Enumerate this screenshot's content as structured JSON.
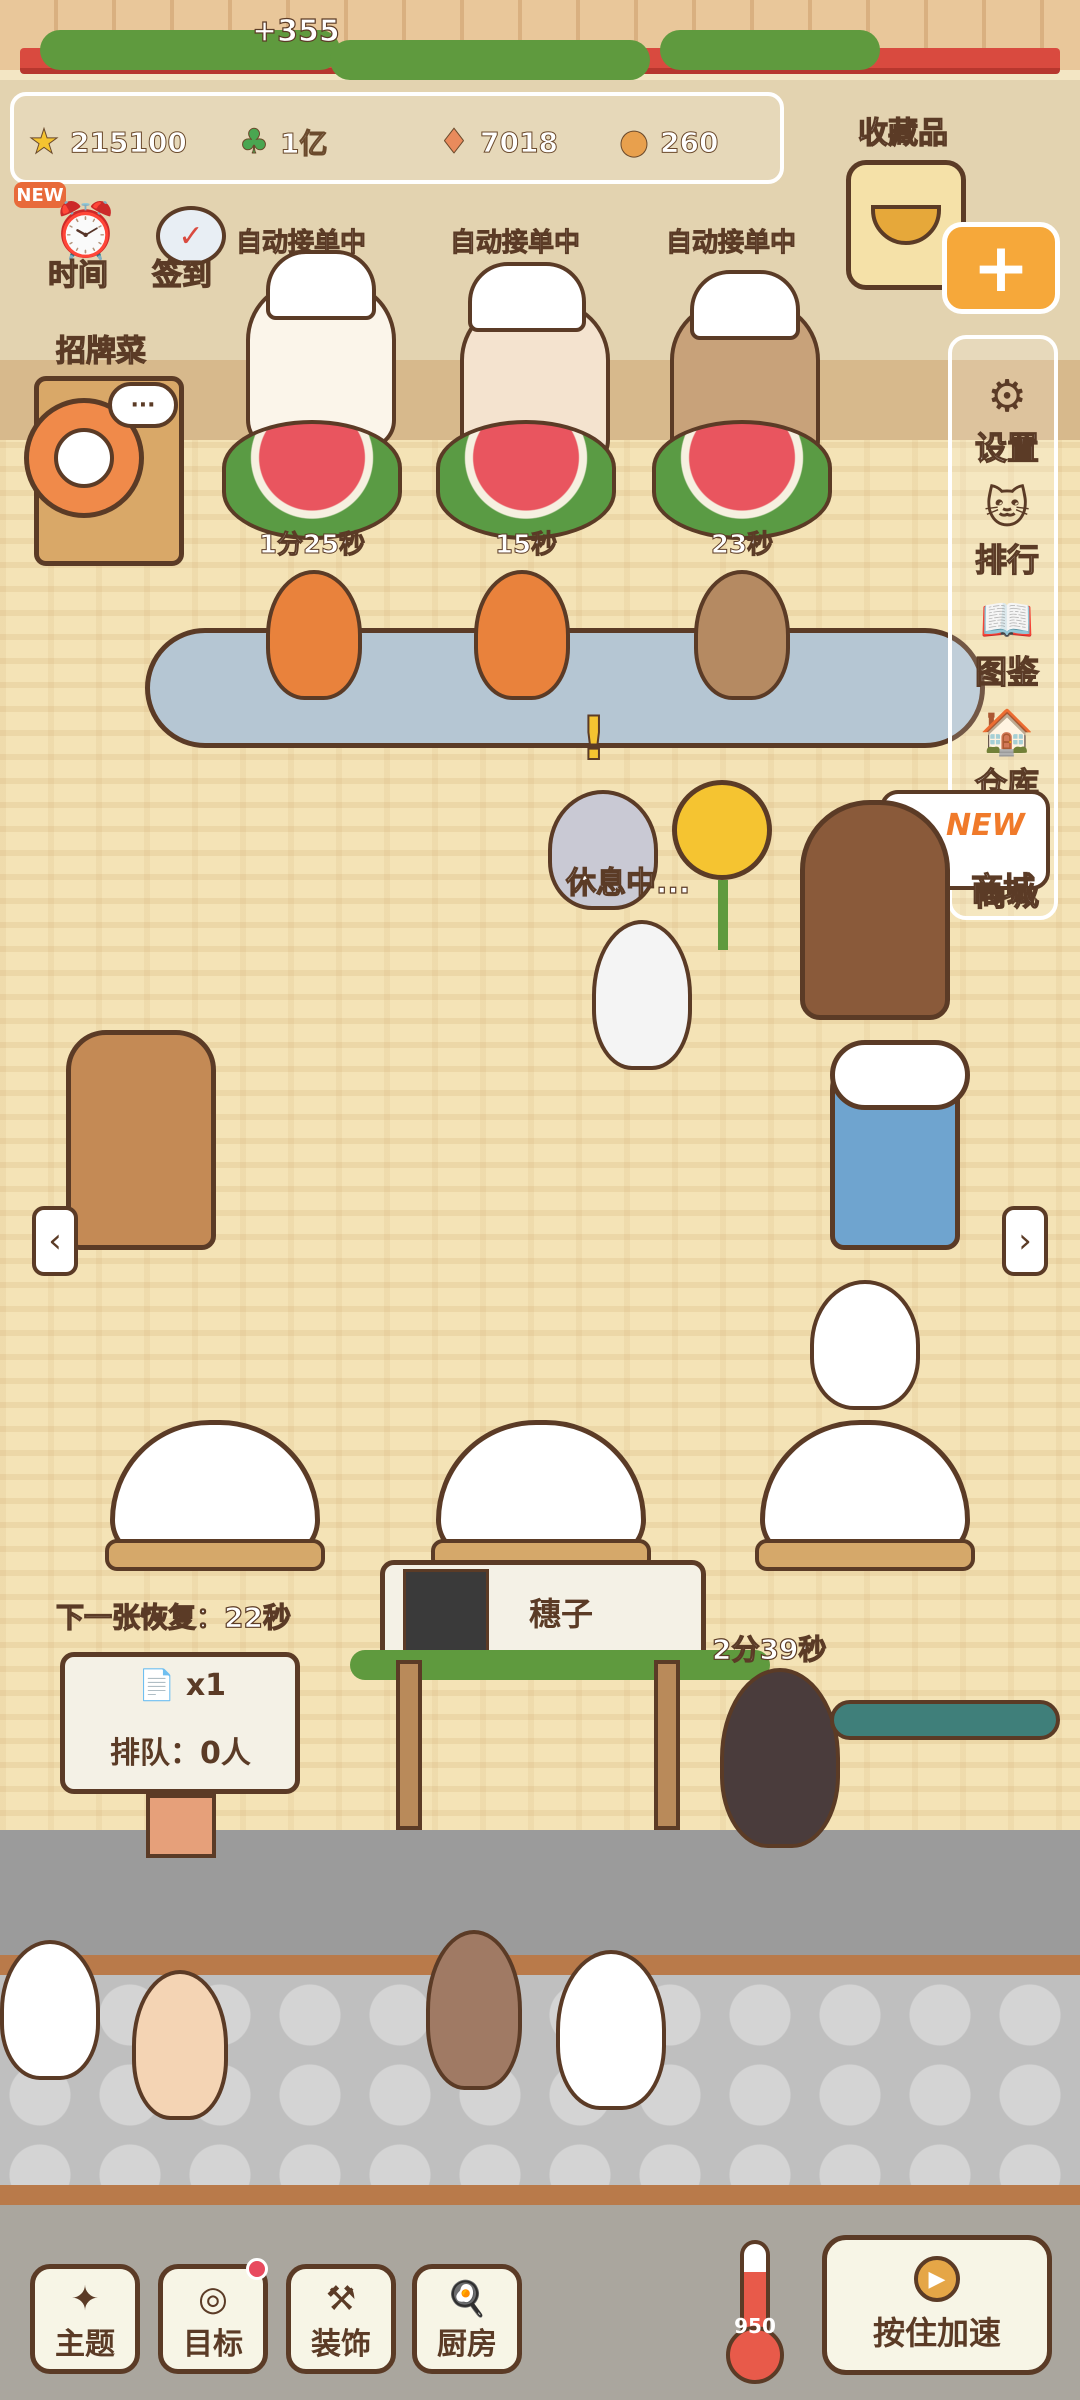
{
  "floating_reward": "+355",
  "resources": [
    {
      "icon": "star-icon",
      "value": "215100",
      "color": "#f5c431"
    },
    {
      "icon": "clover-icon",
      "value": "1亿",
      "color": "#4aa651"
    },
    {
      "icon": "candy-icon",
      "value": "7018",
      "color": "#e98b5c"
    },
    {
      "icon": "cookie-icon",
      "value": "260",
      "color": "#e8a04d"
    }
  ],
  "top_left": {
    "new_badge": "NEW",
    "time_label": "时间",
    "checkin_label": "签到"
  },
  "collection_label": "收藏品",
  "plus_label": "+",
  "signature_dish_label": "招牌菜",
  "thought_bubble": "···",
  "stations": [
    {
      "status": "自动接单中",
      "timer": "1分25秒"
    },
    {
      "status": "自动接单中",
      "timer": "15秒"
    },
    {
      "status": "自动接单中",
      "timer": "23秒"
    }
  ],
  "side_menu": [
    {
      "icon": "gear-icon",
      "label": "设置"
    },
    {
      "icon": "ranking-icon",
      "label": "排行"
    },
    {
      "icon": "book-icon",
      "label": "图鉴"
    },
    {
      "icon": "warehouse-icon",
      "label": "仓库"
    },
    {
      "icon": "shop-icon",
      "label": "商城",
      "badge": "NEW"
    }
  ],
  "alert_mark": "!",
  "resting_text": "休息中...",
  "nav": {
    "left": "‹",
    "right": "›"
  },
  "recovery_text": "下一张恢复：22秒",
  "queue_sign": {
    "tickets": "x1",
    "queue": "排队：0人"
  },
  "customer_card": {
    "name": "穗子"
  },
  "visitor_timer": "2分39秒",
  "bottom_buttons": [
    {
      "icon": "wand-icon",
      "label": "主题"
    },
    {
      "icon": "target-icon",
      "label": "目标"
    },
    {
      "icon": "hammer-icon",
      "label": "装饰"
    },
    {
      "icon": "cooking-icon",
      "label": "厨房"
    }
  ],
  "thermometer_value": "950",
  "speed_button_label": "按住加速",
  "colors": {
    "accent": "#f2a33a",
    "outline": "#5b3b26",
    "awning": "#d94a3f"
  }
}
